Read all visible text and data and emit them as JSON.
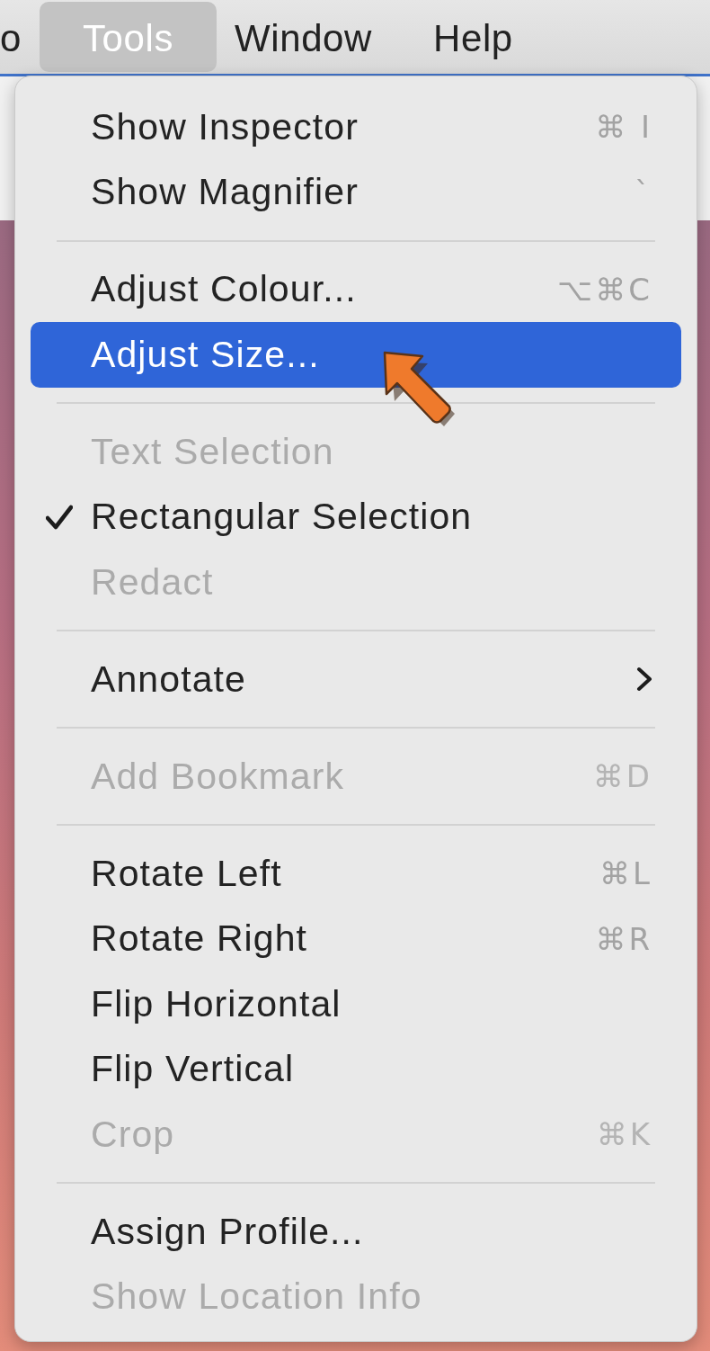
{
  "menu_bar": {
    "items": [
      {
        "label": "o",
        "selected": false
      },
      {
        "label": "Tools",
        "selected": true
      },
      {
        "label": "Window",
        "selected": false
      },
      {
        "label": "Help",
        "selected": false
      }
    ]
  },
  "menu": {
    "items": [
      {
        "kind": "item",
        "label": "Show Inspector",
        "shortcut": "⌘ I",
        "disabled": false,
        "checked": false,
        "selected": false,
        "submenu": false
      },
      {
        "kind": "item",
        "label": "Show Magnifier",
        "shortcut": "`",
        "disabled": false,
        "checked": false,
        "selected": false,
        "submenu": false
      },
      {
        "kind": "separator"
      },
      {
        "kind": "item",
        "label": "Adjust Colour...",
        "shortcut": "⌥⌘C",
        "disabled": false,
        "checked": false,
        "selected": false,
        "submenu": false
      },
      {
        "kind": "item",
        "label": "Adjust Size...",
        "disabled": false,
        "checked": false,
        "selected": true,
        "submenu": false
      },
      {
        "kind": "separator"
      },
      {
        "kind": "item",
        "label": "Text Selection",
        "disabled": true,
        "checked": false,
        "selected": false,
        "submenu": false
      },
      {
        "kind": "item",
        "label": "Rectangular Selection",
        "disabled": false,
        "checked": true,
        "selected": false,
        "submenu": false
      },
      {
        "kind": "item",
        "label": "Redact",
        "disabled": true,
        "checked": false,
        "selected": false,
        "submenu": false
      },
      {
        "kind": "separator"
      },
      {
        "kind": "item",
        "label": "Annotate",
        "disabled": false,
        "checked": false,
        "selected": false,
        "submenu": true
      },
      {
        "kind": "separator"
      },
      {
        "kind": "item",
        "label": "Add Bookmark",
        "shortcut": "⌘D",
        "disabled": true,
        "checked": false,
        "selected": false,
        "submenu": false
      },
      {
        "kind": "separator"
      },
      {
        "kind": "item",
        "label": "Rotate Left",
        "shortcut": "⌘L",
        "disabled": false,
        "checked": false,
        "selected": false,
        "submenu": false
      },
      {
        "kind": "item",
        "label": "Rotate Right",
        "shortcut": "⌘R",
        "disabled": false,
        "checked": false,
        "selected": false,
        "submenu": false
      },
      {
        "kind": "item",
        "label": "Flip Horizontal",
        "disabled": false,
        "checked": false,
        "selected": false,
        "submenu": false
      },
      {
        "kind": "item",
        "label": "Flip Vertical",
        "disabled": false,
        "checked": false,
        "selected": false,
        "submenu": false
      },
      {
        "kind": "item",
        "label": "Crop",
        "shortcut": "⌘K",
        "disabled": true,
        "checked": false,
        "selected": false,
        "submenu": false
      },
      {
        "kind": "separator"
      },
      {
        "kind": "item",
        "label": "Assign Profile...",
        "disabled": false,
        "checked": false,
        "selected": false,
        "submenu": false
      },
      {
        "kind": "item",
        "label": "Show Location Info",
        "disabled": true,
        "checked": false,
        "selected": false,
        "submenu": false
      }
    ]
  }
}
